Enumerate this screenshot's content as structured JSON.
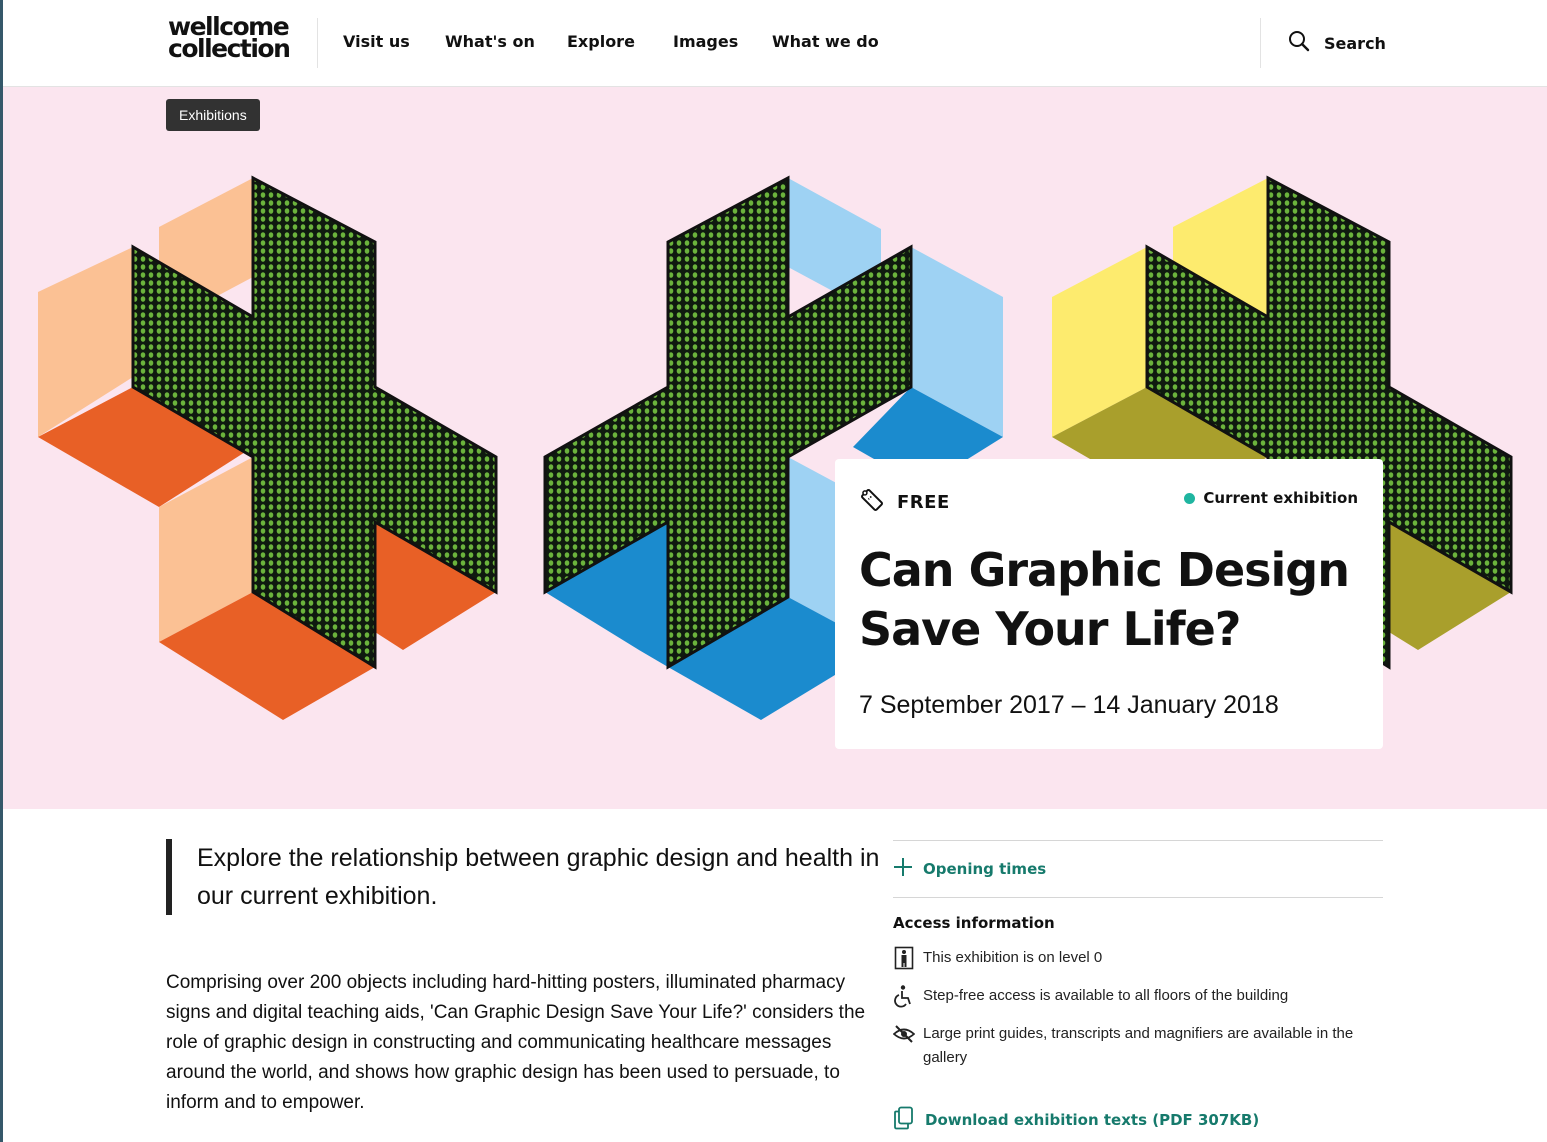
{
  "header": {
    "logo_line1": "wellcome",
    "logo_line2": "collection",
    "nav": [
      "Visit us",
      "What's on",
      "Explore",
      "Images",
      "What we do"
    ],
    "active_nav": "What's on",
    "search_label": "Search"
  },
  "hero": {
    "tag": "Exhibitions",
    "price": "FREE",
    "status": "Current exhibition",
    "title": "Can Graphic Design Save Your Life?",
    "dates": "7 September 2017 – 14 January 2018"
  },
  "content": {
    "standfirst": "Explore the relationship between graphic design and health in our current exhibition.",
    "body": "Comprising over 200 objects including hard-hitting posters, illuminated pharmacy signs and digital teaching aids, 'Can Graphic Design Save Your Life?' considers the role of graphic design in constructing and communicating healthcare messages around the world, and shows how graphic design has been used to persuade, to inform and to empower."
  },
  "sidebar": {
    "opening_times": "Opening times",
    "access_heading": "Access information",
    "access_items": [
      {
        "icon": "level-icon",
        "text": "This exhibition is on level 0"
      },
      {
        "icon": "step-free-icon",
        "text": "Step-free access is available to all floors of the building"
      },
      {
        "icon": "large-print-icon",
        "text": "Large print guides, transcripts and magnifiers are available in the gallery"
      }
    ],
    "download": "Download exhibition texts (PDF 307KB)"
  },
  "colors": {
    "hero_bg": "#fbe5ef",
    "accent_green": "#167a6c",
    "status_dot": "#1fb5a0",
    "nav_underline": "#ffce3c",
    "cross_orange": [
      "#fbc194",
      "#e86026"
    ],
    "cross_blue": [
      "#9ed2f3",
      "#1b8bce"
    ],
    "cross_yellow": [
      "#fdeb6e",
      "#a99f2c"
    ],
    "led_green": "#6bb33c"
  }
}
